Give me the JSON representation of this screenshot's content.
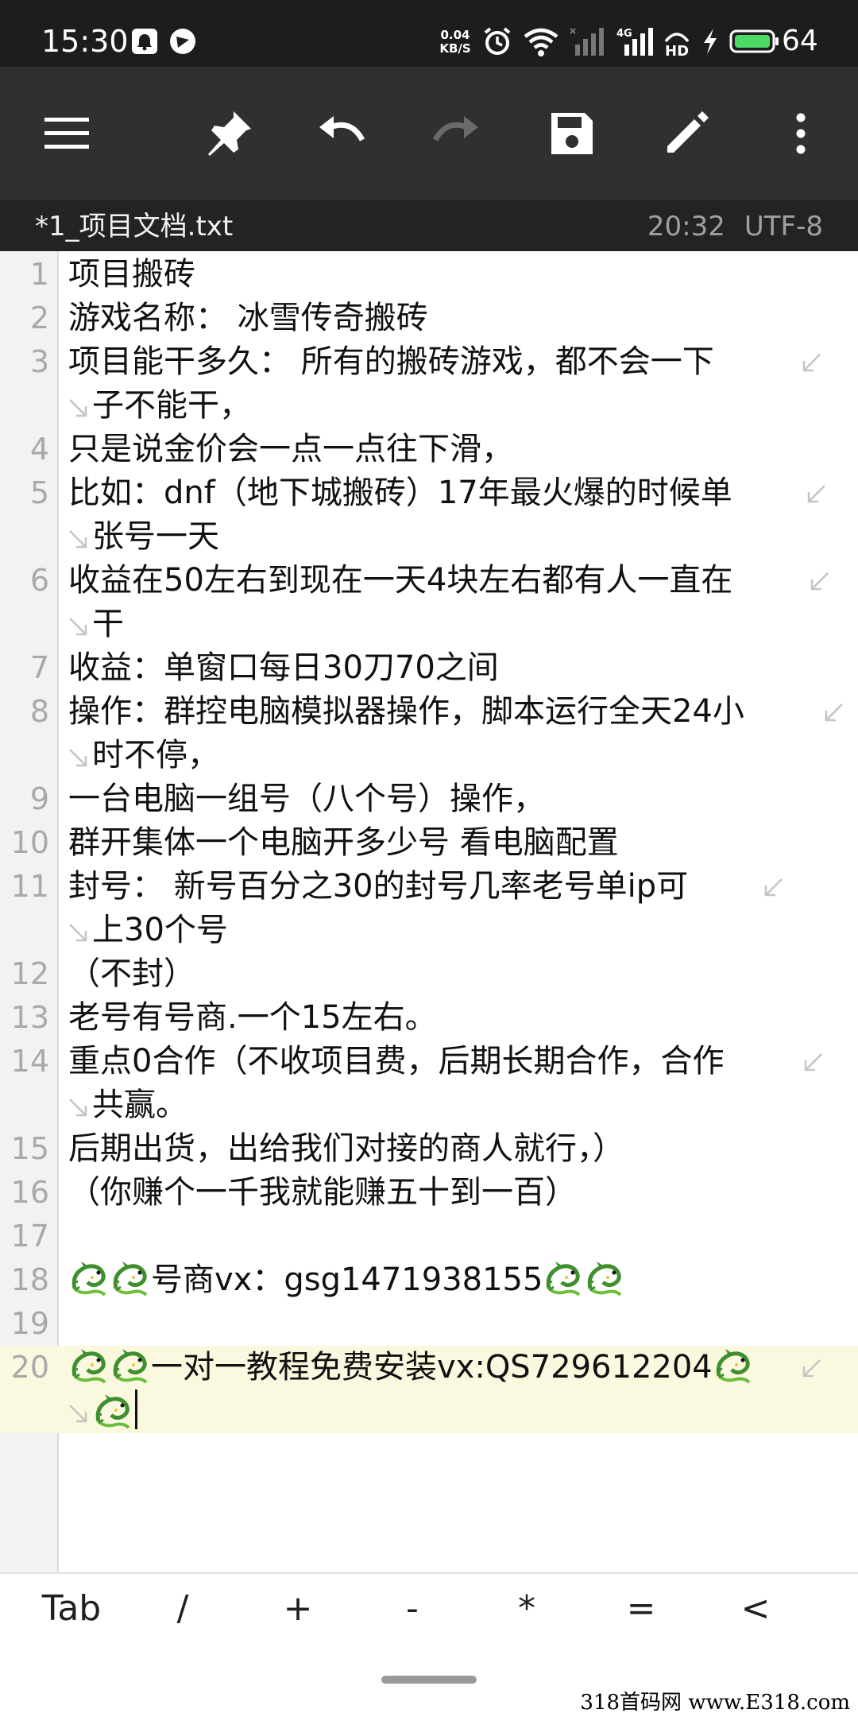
{
  "status_bar": {
    "time": "15:30",
    "net_speed_value": "0.04",
    "net_speed_unit": "KB/S",
    "battery_level": "64",
    "icons": [
      "notification-icon",
      "app-notification-icon",
      "alarm-icon",
      "wifi-icon",
      "signal-icon",
      "4g-signal-icon",
      "hd-icon",
      "charging-icon",
      "battery-icon"
    ]
  },
  "toolbar": {
    "buttons": [
      "menu-icon",
      "pin-icon",
      "undo-icon",
      "redo-icon",
      "save-icon",
      "edit-icon",
      "more-icon"
    ]
  },
  "file_bar": {
    "file_name": "*1_项目文档.txt",
    "time": "20:32",
    "encoding": "UTF-8"
  },
  "editor": {
    "lines": [
      {
        "num": "1",
        "text": "项目搬砖"
      },
      {
        "num": "2",
        "text": "游戏名称： 冰雪传奇搬砖"
      },
      {
        "num": "3",
        "text": "项目能干多久： 所有的搬砖游戏，都不会一下",
        "cont": "子不能干，"
      },
      {
        "num": "4",
        "text": "只是说金价会一点一点往下滑，"
      },
      {
        "num": "5",
        "text": "比如：dnf（地下城搬砖）17年最火爆的时候单",
        "cont": "张号一天"
      },
      {
        "num": "6",
        "text": "收益在50左右到现在一天4块左右都有人一直在",
        "cont": "干"
      },
      {
        "num": "7",
        "text": "收益：单窗口每日30刀70之间"
      },
      {
        "num": "8",
        "text": "操作：群控电脑模拟器操作，脚本运行全天24小",
        "cont": "时不停，"
      },
      {
        "num": "9",
        "text": "一台电脑一组号（八个号）操作，"
      },
      {
        "num": "10",
        "text": "群开集体一个电脑开多少号 看电脑配置"
      },
      {
        "num": "11",
        "text": "封号： 新号百分之30的封号几率老号单ip可",
        "cont": "上30个号"
      },
      {
        "num": "12",
        "text": "（不封）"
      },
      {
        "num": "13",
        "text": "老号有号商.一个15左右。"
      },
      {
        "num": "14",
        "text": "重点0合作（不收项目费，后期长期合作，合作",
        "cont": "共赢。"
      },
      {
        "num": "15",
        "text": "后期出货，出给我们对接的商人就行，）"
      },
      {
        "num": "16",
        "text": "（你赚个一千我就能赚五十到一百）"
      },
      {
        "num": "17",
        "text": ""
      },
      {
        "num": "18",
        "text": "号商vx：gsg1471938155"
      },
      {
        "num": "19",
        "text": ""
      },
      {
        "num": "20",
        "text": "一对一教程免费安装vx:QS729612204"
      }
    ]
  },
  "symbol_bar": {
    "keys": [
      "Tab",
      "/",
      "+",
      "-",
      "*",
      "=",
      "<"
    ]
  },
  "watermark": "318首码网 www.E318.com",
  "colors": {
    "status_bar_bg": "#1d1d1d",
    "toolbar_bg": "#303030",
    "file_bar_bg": "#232323",
    "gutter_bg": "#f2f2f2",
    "current_line_bg": "#fbf8e0"
  }
}
